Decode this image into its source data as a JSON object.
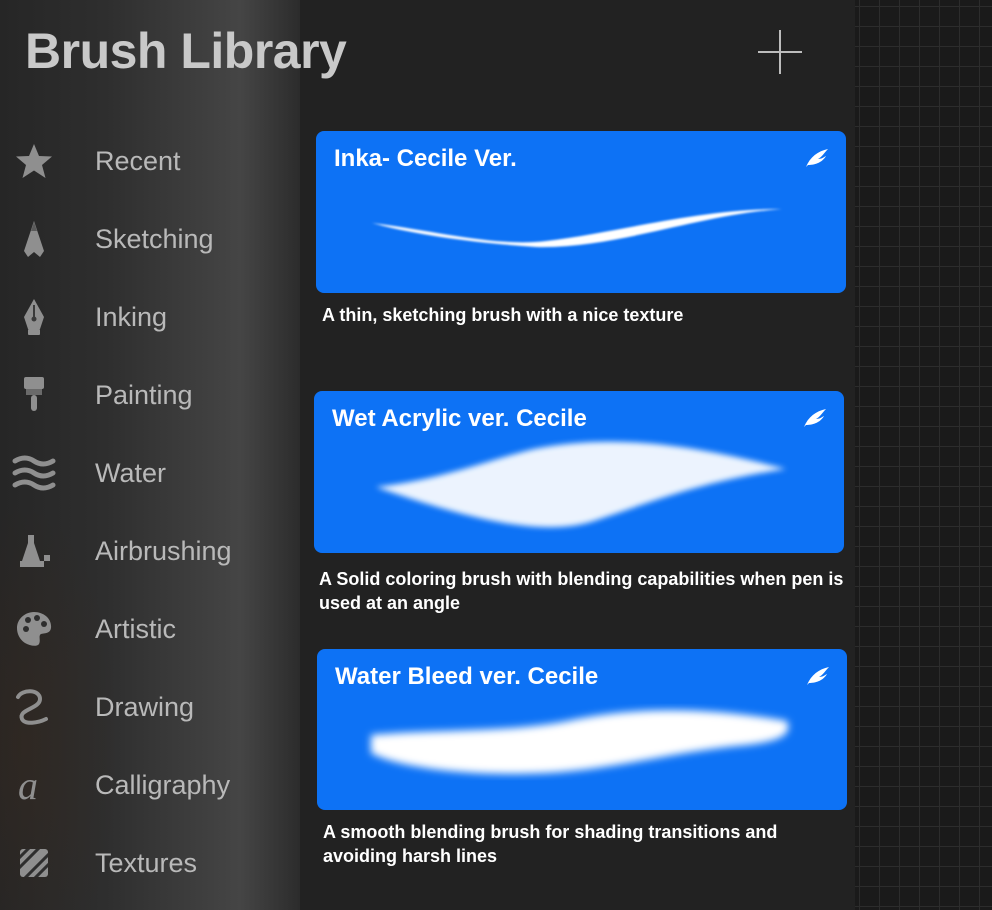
{
  "header": {
    "title": "Brush Library"
  },
  "sidebar": {
    "items": [
      {
        "label": "Recent",
        "icon": "star-icon"
      },
      {
        "label": "Sketching",
        "icon": "pencil-tip-icon"
      },
      {
        "label": "Inking",
        "icon": "pen-nib-icon"
      },
      {
        "label": "Painting",
        "icon": "paint-brush-icon"
      },
      {
        "label": "Water",
        "icon": "water-waves-icon"
      },
      {
        "label": "Airbrushing",
        "icon": "airbrush-icon"
      },
      {
        "label": "Artistic",
        "icon": "palette-icon"
      },
      {
        "label": "Drawing",
        "icon": "curl-stroke-icon"
      },
      {
        "label": "Calligraphy",
        "icon": "calligraphy-a-icon"
      },
      {
        "label": "Textures",
        "icon": "hatched-square-icon"
      }
    ]
  },
  "brushes": [
    {
      "name": "Inka- Cecile Ver.",
      "description": "A thin, sketching brush with a nice texture"
    },
    {
      "name": "Wet Acrylic ver. Cecile",
      "description": "A Solid coloring brush with blending capabilities when pen is used at an angle"
    },
    {
      "name": "Water Bleed ver. Cecile",
      "description": "A smooth blending brush for shading transitions and avoiding harsh lines"
    }
  ],
  "colors": {
    "card": "#0d72f5",
    "text": "#b9b9b9",
    "title": "#c9c9c9"
  }
}
